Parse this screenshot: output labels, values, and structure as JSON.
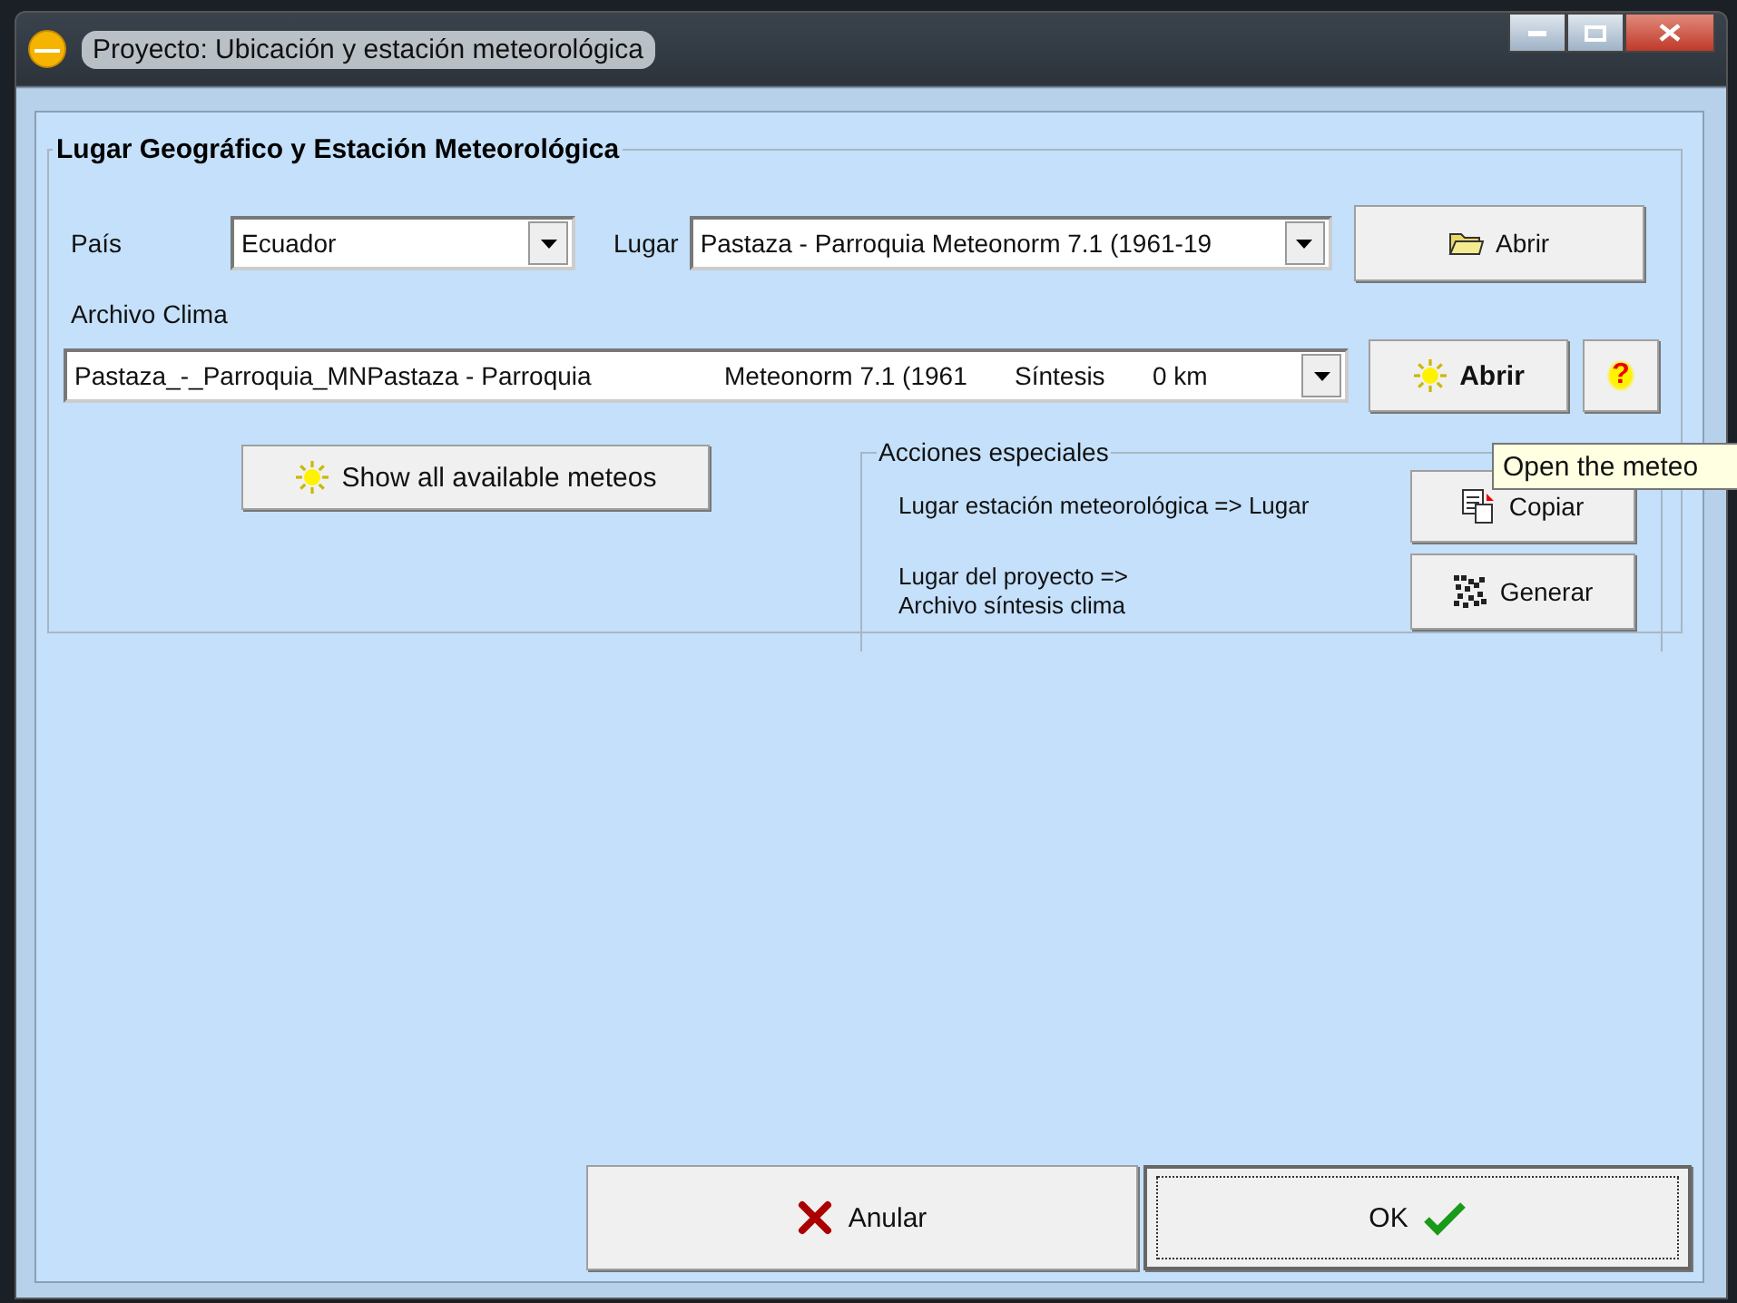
{
  "window": {
    "title": "Proyecto: Ubicación y estación meteorológica"
  },
  "location_group": {
    "title": "Lugar Geográfico y Estación Meteorológica",
    "country": {
      "label": "País",
      "value": "Ecuador"
    },
    "place": {
      "label": "Lugar",
      "value": "Pastaza - Parroquia  Meteonorm 7.1 (1961-19"
    },
    "open_place_button": "Abrir",
    "climate_file": {
      "label": "Archivo Clima",
      "columns": [
        "Pastaza_-_Parroquia_MNPastaza - Parroquia",
        "Meteonorm 7.1 (1961",
        "Síntesis",
        "0 km"
      ]
    },
    "open_meteo_button": "Abrir",
    "help_button": "?",
    "show_all_button": "Show all available meteos",
    "special_actions": {
      "title": "Acciones especiales",
      "rows": [
        {
          "kind": "copy",
          "label": "Lugar estación meteorológica => Lugar",
          "button": "Copiar"
        },
        {
          "kind": "generate",
          "label": "Lugar del proyecto =>\nArchivo síntesis clima",
          "button": "Generar"
        }
      ]
    }
  },
  "tooltip": "Open the meteo",
  "buttons": [
    {
      "kind": "cancel",
      "label": "Anular",
      "focused": false
    },
    {
      "kind": "ok",
      "label": "OK",
      "focused": true
    }
  ]
}
